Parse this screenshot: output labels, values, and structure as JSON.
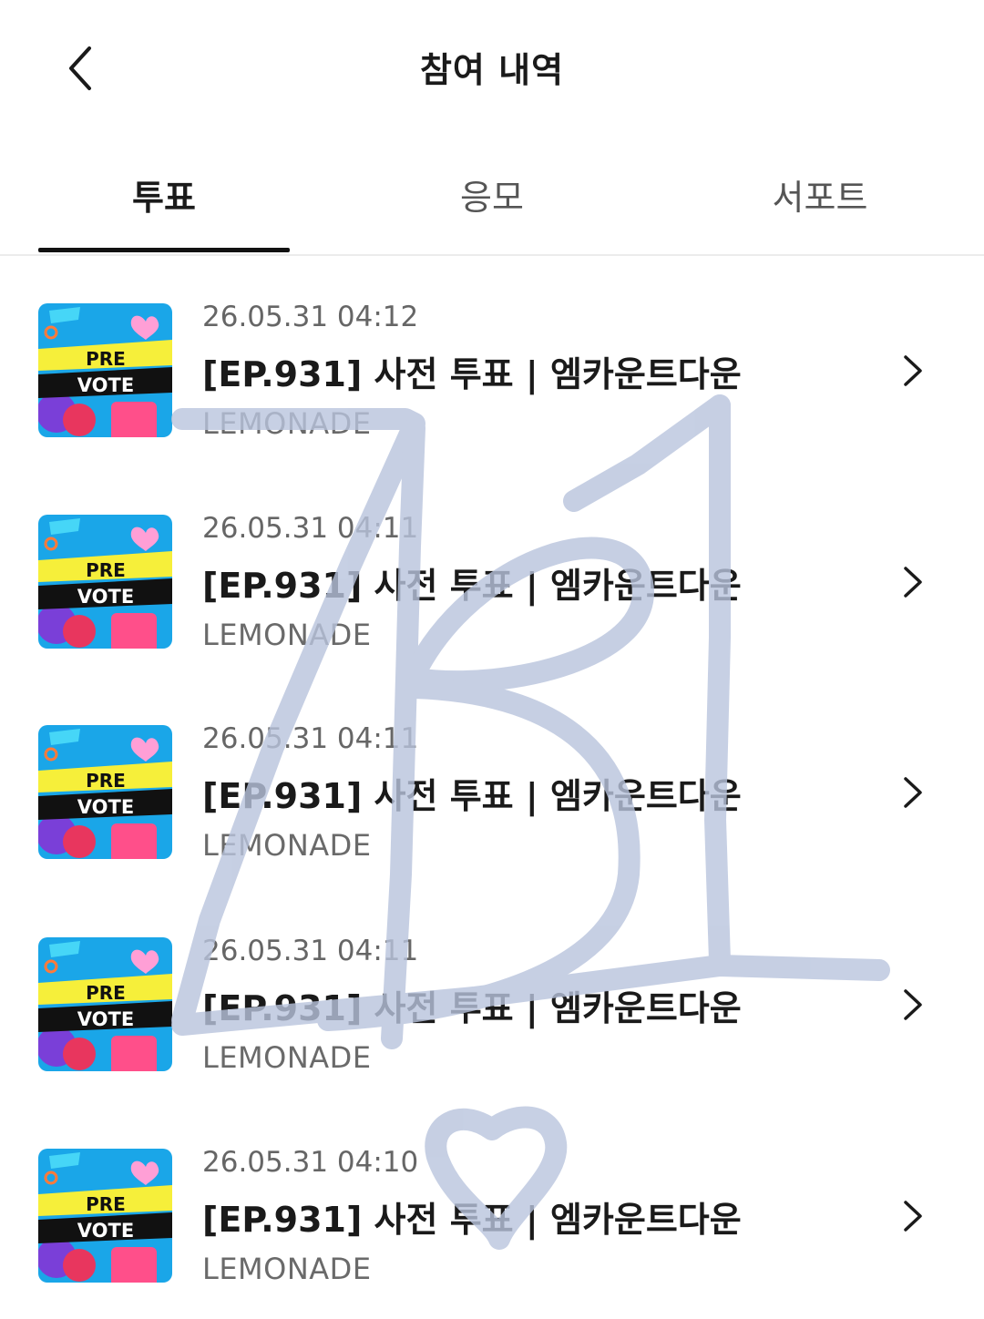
{
  "header": {
    "title": "참여 내역"
  },
  "tabs": [
    {
      "label": "투표",
      "active": true
    },
    {
      "label": "응모",
      "active": false
    },
    {
      "label": "서포트",
      "active": false
    }
  ],
  "thumbnail": {
    "text_line1": "PRE",
    "text_line2": "VOTE"
  },
  "items": [
    {
      "date": "26.05.31 04:12",
      "title": "[EP.931] 사전 투표 | 엠카운트다운",
      "org": "LEMONADE"
    },
    {
      "date": "26.05.31 04:11",
      "title": "[EP.931] 사전 투표 | 엠카운트다운",
      "org": "LEMONADE"
    },
    {
      "date": "26.05.31 04:11",
      "title": "[EP.931] 사전 투표 | 엠카운트다운",
      "org": "LEMONADE"
    },
    {
      "date": "26.05.31 04:11",
      "title": "[EP.931] 사전 투표 | 엠카운트다운",
      "org": "LEMONADE"
    },
    {
      "date": "26.05.31 04:10",
      "title": "[EP.931] 사전 투표 | 엠카운트다운",
      "org": "LEMONADE"
    }
  ],
  "colors": {
    "scribble": "#b9c4dd",
    "thumb_bg": "#1aa6e8",
    "thumb_banner": "#f6ef3a",
    "thumb_dark": "#111111"
  }
}
